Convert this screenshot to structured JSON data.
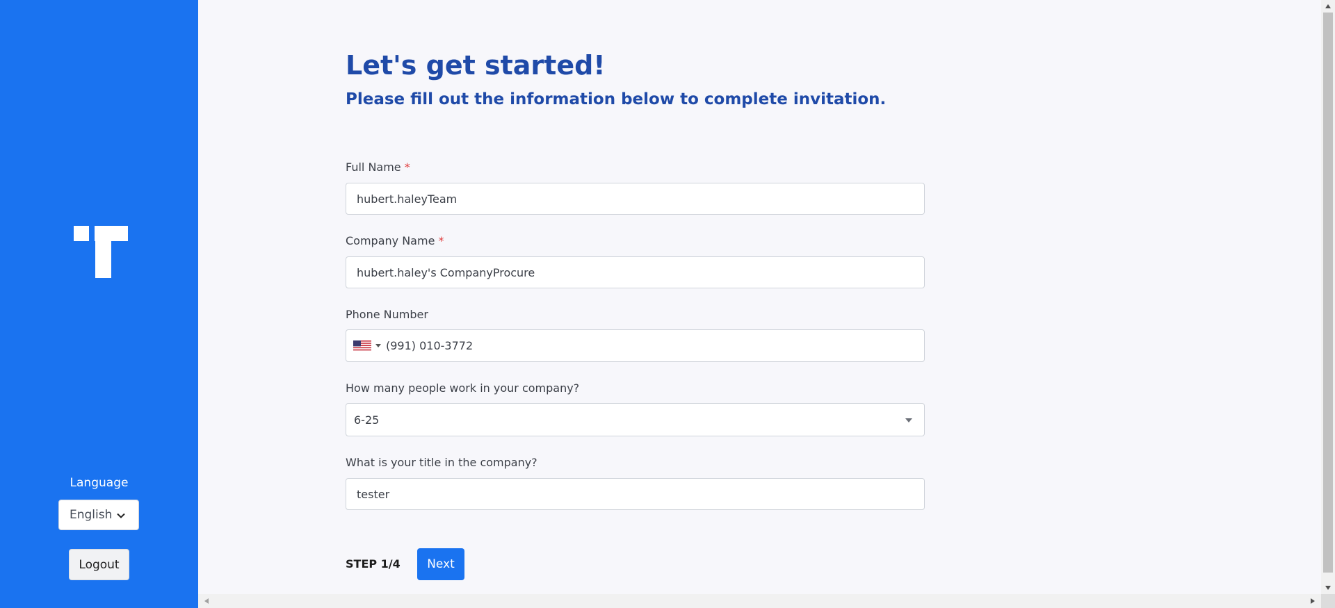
{
  "sidebar": {
    "language_label": "Language",
    "language_selected": "English",
    "logout_label": "Logout",
    "brand_color": "#1a73f0"
  },
  "header": {
    "title": "Let's get started!",
    "subtitle": "Please fill out the information below to complete invitation."
  },
  "form": {
    "full_name": {
      "label": "Full Name",
      "required_mark": "*",
      "value": "hubert.haleyTeam"
    },
    "company_name": {
      "label": "Company Name",
      "required_mark": "*",
      "value": "hubert.haley's CompanyProcure"
    },
    "phone": {
      "label": "Phone Number",
      "country_icon": "us-flag-icon",
      "value": "(991) 010-3772"
    },
    "company_size": {
      "label": "How many people work in your company?",
      "selected": "6-25"
    },
    "title": {
      "label": "What is your title in the company?",
      "value": "tester"
    }
  },
  "footer": {
    "step_label": "STEP 1/4",
    "next_label": "Next"
  },
  "colors": {
    "heading": "#1f4aa8",
    "required": "#e03a3a",
    "primary": "#1a73f0"
  }
}
